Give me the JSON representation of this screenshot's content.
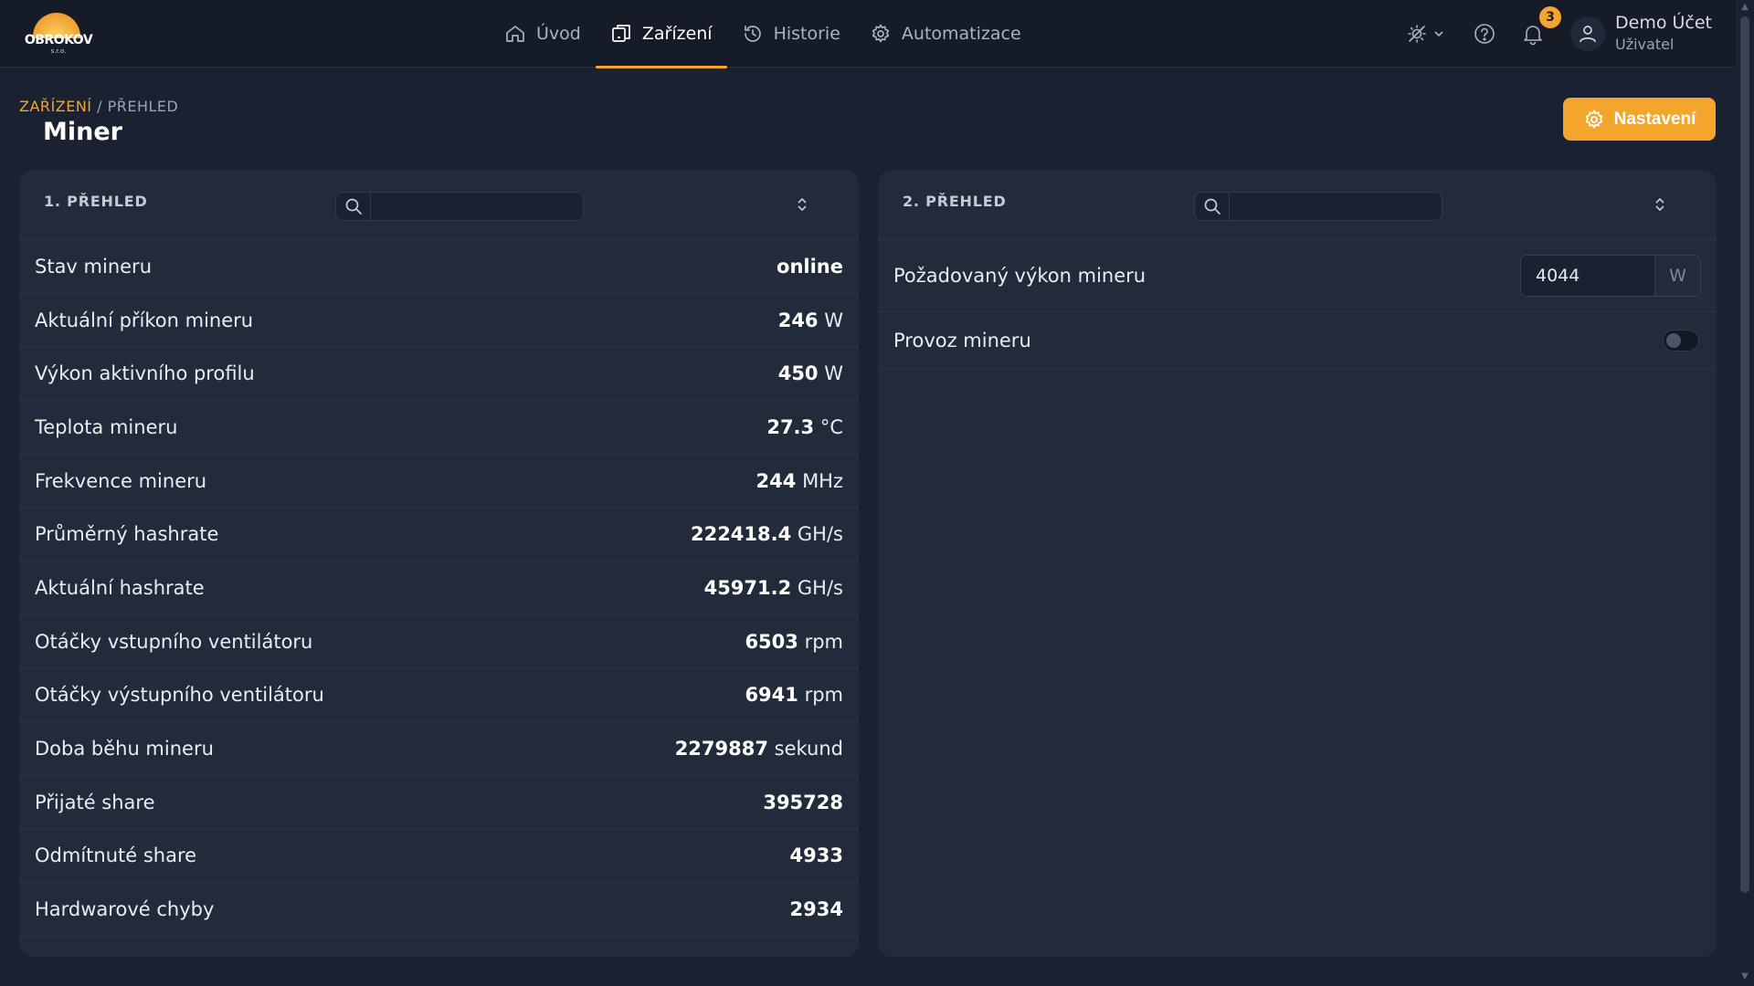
{
  "brand": {
    "name": "OBROKOV",
    "sub": "s.r.o."
  },
  "nav": [
    {
      "label": "Úvod",
      "icon": "home-icon",
      "active": false
    },
    {
      "label": "Zařízení",
      "icon": "devices-icon",
      "active": true
    },
    {
      "label": "Historie",
      "icon": "history-icon",
      "active": false
    },
    {
      "label": "Automatizace",
      "icon": "gear-icon",
      "active": false
    }
  ],
  "topbar": {
    "notification_count": "3",
    "user_name": "Demo Účet",
    "user_role": "Uživatel"
  },
  "breadcrumb": {
    "parent": "ZAŘÍZENÍ",
    "separator": " / ",
    "current": "PŘEHLED"
  },
  "page": {
    "title": "Miner",
    "settings_label": "Nastavení"
  },
  "colors": {
    "accent": "#f4a52c",
    "background": "#1a2130",
    "panel": "#222b3a"
  },
  "panel1": {
    "title": "1. PŘEHLED",
    "search_value": "",
    "rows": [
      {
        "label": "Stav mineru",
        "value": "online",
        "unit": ""
      },
      {
        "label": "Aktuální příkon mineru",
        "value": "246",
        "unit": " W"
      },
      {
        "label": "Výkon aktivního profilu",
        "value": "450",
        "unit": " W"
      },
      {
        "label": "Teplota mineru",
        "value": "27.3",
        "unit": " °C"
      },
      {
        "label": "Frekvence mineru",
        "value": "244",
        "unit": " MHz"
      },
      {
        "label": "Průměrný hashrate",
        "value": "222418.4",
        "unit": " GH/s"
      },
      {
        "label": "Aktuální hashrate",
        "value": "45971.2",
        "unit": " GH/s"
      },
      {
        "label": "Otáčky vstupního ventilátoru",
        "value": "6503",
        "unit": " rpm"
      },
      {
        "label": "Otáčky výstupního ventilátoru",
        "value": "6941",
        "unit": " rpm"
      },
      {
        "label": "Doba běhu mineru",
        "value": "2279887",
        "unit": " sekund"
      },
      {
        "label": "Přijaté share",
        "value": "395728",
        "unit": ""
      },
      {
        "label": "Odmítnuté share",
        "value": "4933",
        "unit": ""
      },
      {
        "label": "Hardwarové chyby",
        "value": "2934",
        "unit": ""
      }
    ]
  },
  "panel2": {
    "title": "2. PŘEHLED",
    "search_value": "",
    "power": {
      "label": "Požadovaný výkon mineru",
      "value": "4044",
      "unit": "W"
    },
    "operation": {
      "label": "Provoz mineru",
      "enabled": false
    }
  }
}
